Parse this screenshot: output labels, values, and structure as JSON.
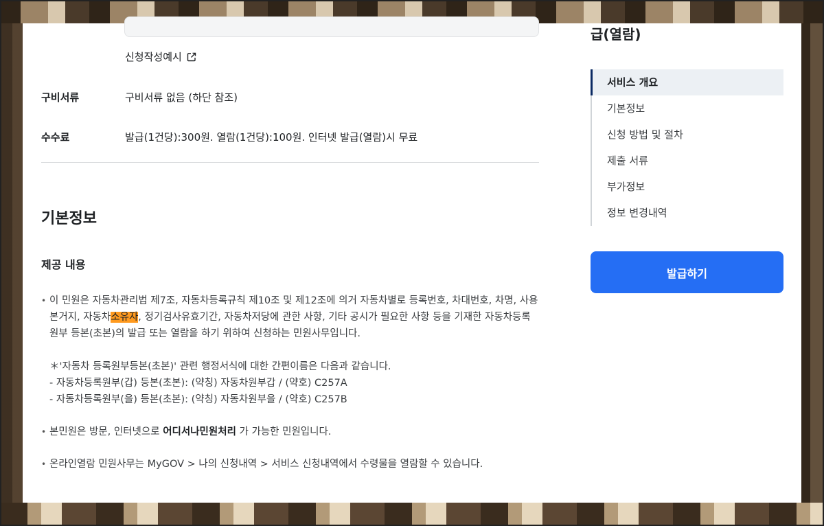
{
  "main": {
    "example_link": "신청작성예시",
    "rows": [
      {
        "label": "구비서류",
        "value": "구비서류 없음 (하단 참조)"
      },
      {
        "label": "수수료",
        "value": "발급(1건당):300원. 열람(1건당):100원. 인터넷 발급(열람)시 무료"
      }
    ],
    "section_title": "기본정보",
    "subsection_title": "제공 내용",
    "para1_before": "이 민원은 자동차관리법 제7조, 자동차등록규칙 제10조 및 제12조에 의거 자동차별로 등록번호, 차대번호, 차명, 사용본거지, 자동차",
    "para1_highlight": "소유자",
    "para1_after": ", 정기검사유효기간, 자동차저당에 관한 사항, 기타 공시가 필요한 사항 등을 기재한 자동차등록원부 등본(초본)의 발급 또는 열람을 하기 위하여 신청하는 민원사무입니다.",
    "note_lines": [
      "＊'자동차 등록원부등본(초본)' 관련 행정서식에 대한 간편이름은 다음과 같습니다.",
      "- 자동차등록원부(갑) 등본(초본): (약칭) 자동차원부갑 / (약호) C257A",
      "- 자동차등록원부(을) 등본(초본): (약칭) 자동차원부을 / (약호) C257B"
    ],
    "para2_before": "본민원은 방문, 인터넷으로 ",
    "para2_strong": "어디서나민원처리",
    "para2_after": " 가 가능한 민원입니다.",
    "para3": "온라인열람 민원사무는 MyGOV > 나의 신청내역 > 서비스 신청내역에서 수령물을 열람할 수 있습니다."
  },
  "sidebar": {
    "title": "급(열람)",
    "toc": [
      "서비스 개요",
      "기본정보",
      "신청 방법 및 절차",
      "제출 서류",
      "부가정보",
      "정보 변경내역"
    ],
    "active_index": 0,
    "button_label": "발급하기"
  },
  "colors": {
    "primary_button": "#256ef4",
    "active_toc_bar": "#0b2a63",
    "highlight": "#ff9a1f"
  }
}
